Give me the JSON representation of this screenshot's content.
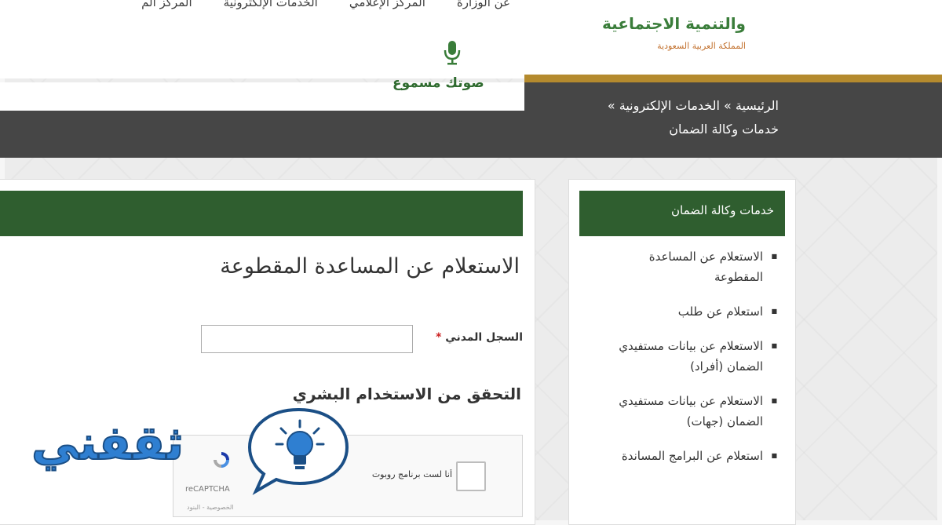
{
  "header": {
    "logo_title": "والتنمية الاجتماعية",
    "logo_subtitle": "المملكة العربية السعودية",
    "top_nav": [
      "عن الوزارة",
      "المركز الإعلامي",
      "الخدمات الإلكترونية",
      "المركز الم"
    ],
    "voice_label": "صوتك مسموع"
  },
  "breadcrumb": {
    "line1": "الرئيسية » الخدمات الإلكترونية »",
    "line2": "خدمات وكالة الضمان"
  },
  "sidebar": {
    "title": "خدمات وكالة الضمان",
    "items": [
      "الاستعلام عن المساعدة المقطوعة",
      "استعلام عن طلب",
      "الاستعلام عن بيانات مستفيدي الضمان (أفراد)",
      "الاستعلام عن بيانات مستفيدي الضمان (جهات)",
      "استعلام عن البرامج المساندة"
    ]
  },
  "main": {
    "heading": "الاستعلام عن المساعدة المقطوعة",
    "civil_label": "السجل المدني",
    "required_mark": "*",
    "civil_value": "",
    "verify_heading": "التحقق من الاستخدام البشري",
    "recaptcha": {
      "text": "أنا لست برنامج روبوت",
      "brand": "reCAPTCHA",
      "terms": "الخصوصية - البنود"
    }
  },
  "watermark": {
    "text": "ثقفني"
  },
  "colors": {
    "green": "#2f5e2f",
    "gold": "#b48a2e",
    "dark_bar": "#464646",
    "watermark_blue": "#2f7fd1"
  }
}
